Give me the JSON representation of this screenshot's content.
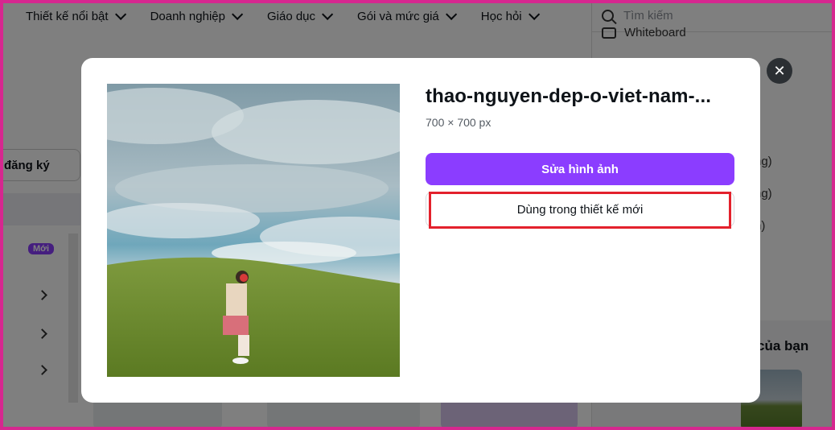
{
  "nav": {
    "items": [
      {
        "label": "Thiết kế nổi bật"
      },
      {
        "label": "Doanh nghiệp"
      },
      {
        "label": "Giáo dục"
      },
      {
        "label": "Gói và mức giá"
      },
      {
        "label": "Học hỏi"
      }
    ]
  },
  "search": {
    "placeholder": "Tìm kiếm"
  },
  "right_panel": {
    "whiteboard": "Whiteboard",
    "frag1": "ng)",
    "frag2": "ng)",
    "frag3": "n)",
    "your_title": "của bạn"
  },
  "left": {
    "signup": "đăng ký",
    "new_badge": "Mới"
  },
  "modal": {
    "title": "thao-nguyen-dep-o-viet-nam-...",
    "dimensions": "700 × 700 px",
    "edit_label": "Sửa hình ảnh",
    "use_label": "Dùng trong thiết kế mới",
    "close_icon": "close-icon"
  },
  "colors": {
    "accent": "#8b3dff",
    "highlight": "#e3212c",
    "frame": "#d6278f"
  }
}
